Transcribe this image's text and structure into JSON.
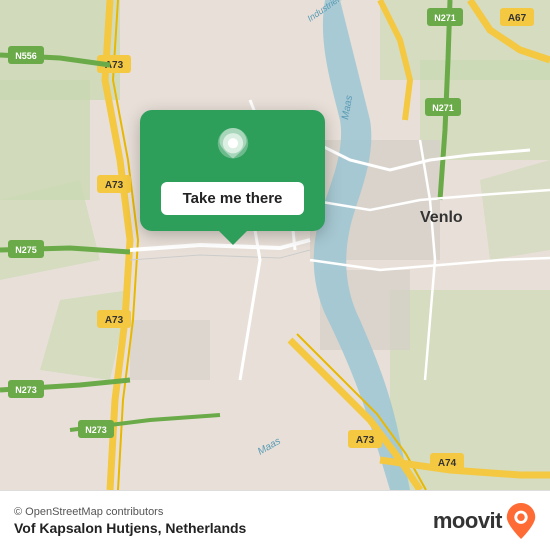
{
  "map": {
    "alt": "Map of Venlo, Netherlands area"
  },
  "popup": {
    "button_label": "Take me there",
    "pin_icon": "location-pin"
  },
  "bottom_bar": {
    "credit": "© OpenStreetMap contributors",
    "location_title": "Vof Kapsalon Hutjens, Netherlands",
    "logo_text": "moovit"
  }
}
